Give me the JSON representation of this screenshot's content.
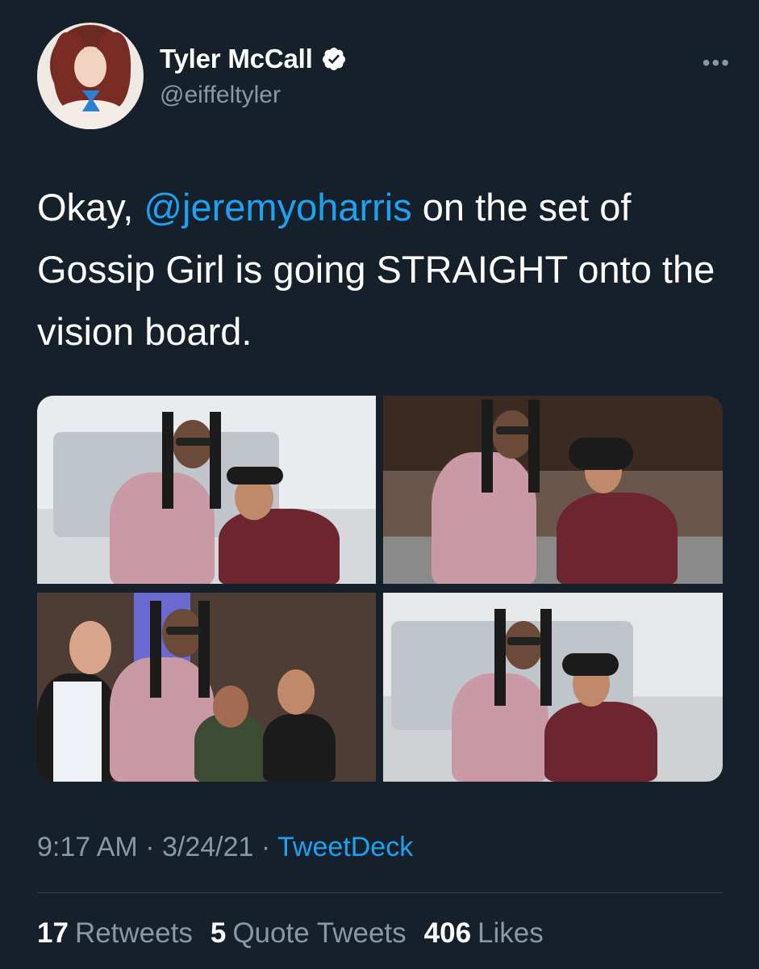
{
  "author": {
    "name": "Tyler McCall",
    "handle": "@eiffeltyler",
    "verified": true,
    "avatar_icon": "profile-photo"
  },
  "more_label": "•••",
  "tweet": {
    "text_before": "Okay, ",
    "mention": "@jeremyoharris",
    "text_after": " on the set of Gossip Girl is going STRAIGHT onto the vision board."
  },
  "meta": {
    "time": "9:17 AM",
    "sep1": " · ",
    "date": "3/24/21",
    "sep2": " · ",
    "source": "TweetDeck"
  },
  "stats": [
    {
      "count": "17",
      "label": "Retweets"
    },
    {
      "count": "5",
      "label": "Quote Tweets"
    },
    {
      "count": "406",
      "label": "Likes"
    }
  ],
  "colors": {
    "background": "#15202b",
    "accent": "#1da1f2",
    "secondary_text": "#8899a6"
  }
}
